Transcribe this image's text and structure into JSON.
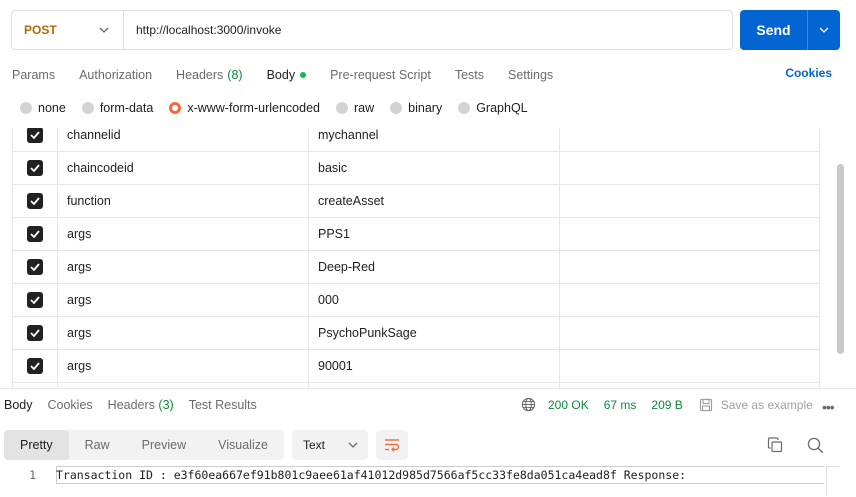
{
  "request": {
    "method": "POST",
    "url": "http://localhost:3000/invoke",
    "send_label": "Send"
  },
  "request_tabs": [
    {
      "label": "Params"
    },
    {
      "label": "Authorization"
    },
    {
      "label": "Headers",
      "count": "(8)"
    },
    {
      "label": "Body"
    },
    {
      "label": "Pre-request Script"
    },
    {
      "label": "Tests"
    },
    {
      "label": "Settings"
    }
  ],
  "cookies_label": "Cookies",
  "body_types": [
    {
      "label": "none",
      "checked": false
    },
    {
      "label": "form-data",
      "checked": false
    },
    {
      "label": "x-www-form-urlencoded",
      "checked": true
    },
    {
      "label": "raw",
      "checked": false
    },
    {
      "label": "binary",
      "checked": false
    },
    {
      "label": "GraphQL",
      "checked": false
    }
  ],
  "params": [
    {
      "key": "channelid",
      "value": "mychannel",
      "enabled": true
    },
    {
      "key": "chaincodeid",
      "value": "basic",
      "enabled": true
    },
    {
      "key": "function",
      "value": "createAsset",
      "enabled": true
    },
    {
      "key": "args",
      "value": "PPS1",
      "enabled": true
    },
    {
      "key": "args",
      "value": "Deep-Red",
      "enabled": true
    },
    {
      "key": "args",
      "value": "000",
      "enabled": true
    },
    {
      "key": "args",
      "value": "PsychoPunkSage",
      "enabled": true
    },
    {
      "key": "args",
      "value": "90001",
      "enabled": true
    }
  ],
  "response": {
    "tabs": [
      {
        "label": "Body"
      },
      {
        "label": "Cookies"
      },
      {
        "label": "Headers",
        "count": "(3)"
      },
      {
        "label": "Test Results"
      }
    ],
    "status": "200 OK",
    "time": "67 ms",
    "size": "209 B",
    "save_example": "Save as example",
    "views": [
      "Pretty",
      "Raw",
      "Preview",
      "Visualize"
    ],
    "format": "Text",
    "lines": [
      {
        "num": "1",
        "text": "Transaction ID : e3f60ea667ef91b801c9aee61af41012d985d7566af5cc33fe8da051ca4ead8f Response:"
      }
    ]
  },
  "colors": {
    "accent": "#0265d2",
    "method": "#b06a00",
    "status_ok": "#0a8a3a",
    "radio_selected": "#f26b3a"
  }
}
